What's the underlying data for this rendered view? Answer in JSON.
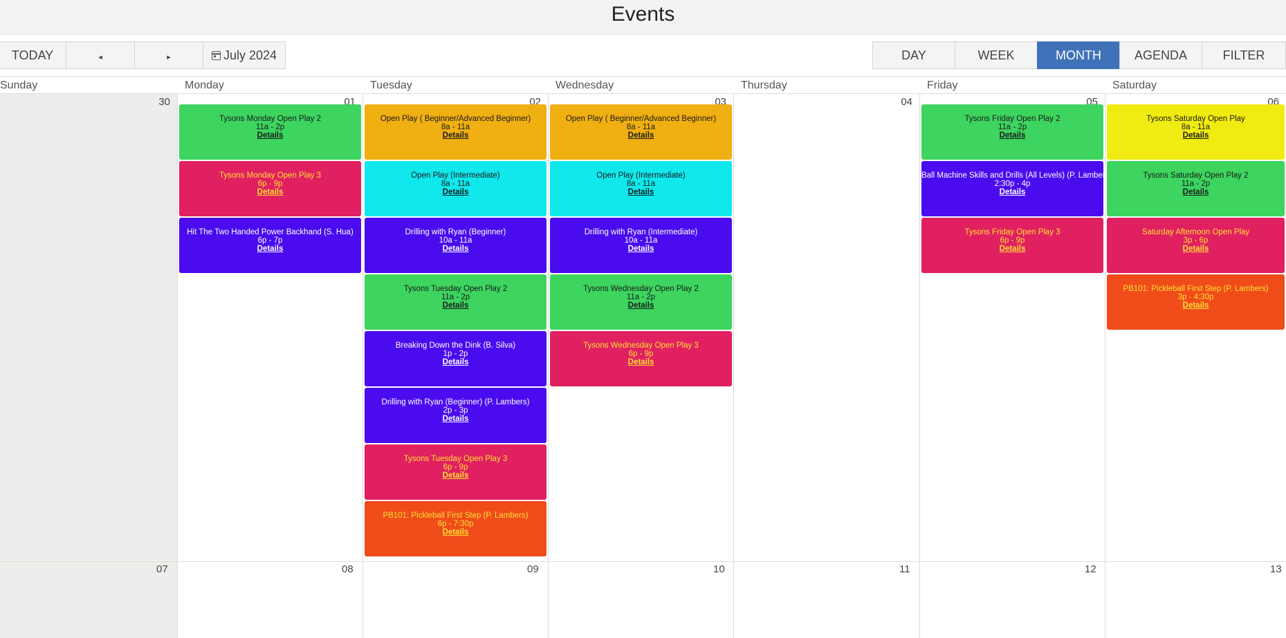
{
  "header": {
    "title": "Events"
  },
  "toolbar": {
    "today_label": "TODAY",
    "prev_glyph": "◂",
    "next_glyph": "▸",
    "month_label": "July 2024",
    "views": [
      "DAY",
      "WEEK",
      "MONTH",
      "AGENDA",
      "FILTER"
    ],
    "active_view": "MONTH"
  },
  "weekdays": [
    "Sunday",
    "Monday",
    "Tuesday",
    "Wednesday",
    "Thursday",
    "Friday",
    "Saturday"
  ],
  "week1": {
    "dates": [
      "30",
      "01",
      "02",
      "03",
      "04",
      "05",
      "06"
    ],
    "days": [
      {
        "events": []
      },
      {
        "events": [
          {
            "title": "Tysons Monday Open Play 2",
            "time": "11a - 2p",
            "details": "Details",
            "color": "green"
          },
          {
            "title": "Tysons Monday Open Play 3",
            "time": "6p - 9p",
            "details": "Details",
            "color": "red"
          },
          {
            "title": "Hit The Two Handed Power Backhand (S. Hua)",
            "time": "6p - 7p",
            "details": "Details",
            "color": "purple"
          }
        ]
      },
      {
        "events": [
          {
            "title": "Open Play ( Beginner/Advanced Beginner)",
            "time": "8a - 11a",
            "details": "Details",
            "color": "orange"
          },
          {
            "title": "Open Play (Intermediate)",
            "time": "8a - 11a",
            "details": "Details",
            "color": "cyan"
          },
          {
            "title": "Drilling with Ryan (Beginner)",
            "time": "10a - 11a",
            "details": "Details",
            "color": "purple"
          },
          {
            "title": "Tysons Tuesday Open Play 2",
            "time": "11a - 2p",
            "details": "Details",
            "color": "green"
          },
          {
            "title": "Breaking Down the Dink (B. Silva)",
            "time": "1p - 2p",
            "details": "Details",
            "color": "purple"
          },
          {
            "title": "Drilling with Ryan (Beginner) (P. Lambers)",
            "time": "2p - 3p",
            "details": "Details",
            "color": "purple"
          },
          {
            "title": "Tysons Tuesday Open Play 3",
            "time": "6p - 9p",
            "details": "Details",
            "color": "red"
          },
          {
            "title": "PB101: Pickleball First Step (P. Lambers)",
            "time": "6p - 7:30p",
            "details": "Details",
            "color": "redorange"
          }
        ]
      },
      {
        "events": [
          {
            "title": "Open Play ( Beginner/Advanced Beginner)",
            "time": "8a - 11a",
            "details": "Details",
            "color": "orange"
          },
          {
            "title": "Open Play (Intermediate)",
            "time": "8a - 11a",
            "details": "Details",
            "color": "cyan"
          },
          {
            "title": "Drilling with Ryan (Intermediate)",
            "time": "10a - 11a",
            "details": "Details",
            "color": "purple"
          },
          {
            "title": "Tysons Wednesday Open Play 2",
            "time": "11a - 2p",
            "details": "Details",
            "color": "green"
          },
          {
            "title": "Tysons Wednesday Open Play 3",
            "time": "6p - 9p",
            "details": "Details",
            "color": "red"
          }
        ]
      },
      {
        "events": []
      },
      {
        "events": [
          {
            "title": "Tysons Friday Open Play 2",
            "time": "11a - 2p",
            "details": "Details",
            "color": "green"
          },
          {
            "title": "Ball Machine Skills and Drills (All Levels) (P. Lambers)",
            "time": "2:30p - 4p",
            "details": "Details",
            "color": "purple"
          },
          {
            "title": "Tysons Friday Open Play 3",
            "time": "6p - 9p",
            "details": "Details",
            "color": "red"
          }
        ]
      },
      {
        "events": [
          {
            "title": "Tysons Saturday Open Play",
            "time": "8a - 11a",
            "details": "Details",
            "color": "yellow"
          },
          {
            "title": "Tysons Saturday Open Play 2",
            "time": "11a - 2p",
            "details": "Details",
            "color": "green"
          },
          {
            "title": "Saturday Afternoon Open Play",
            "time": "3p - 6p",
            "details": "Details",
            "color": "red"
          },
          {
            "title": "PB101: Pickleball First Step (P. Lambers)",
            "time": "3p - 4:30p",
            "details": "Details",
            "color": "redorange"
          }
        ]
      }
    ]
  },
  "week2": {
    "dates": [
      "07",
      "08",
      "09",
      "10",
      "11",
      "12",
      "13"
    ]
  },
  "colors": {
    "green": {
      "bg": "#3dd45f",
      "fg": "#1a1a1a"
    },
    "red": {
      "bg": "#e02060",
      "fg": "#ffe033"
    },
    "purple": {
      "bg": "#4a0cee",
      "fg": "#ffffff"
    },
    "orange": {
      "bg": "#f0b012",
      "fg": "#1a1a1a"
    },
    "cyan": {
      "bg": "#10e8ec",
      "fg": "#1a1a1a"
    },
    "yellow": {
      "bg": "#f0ec12",
      "fg": "#1a1a1a"
    },
    "redorange": {
      "bg": "#f04c1a",
      "fg": "#ffe033"
    },
    "accent": "#3f72b8"
  }
}
